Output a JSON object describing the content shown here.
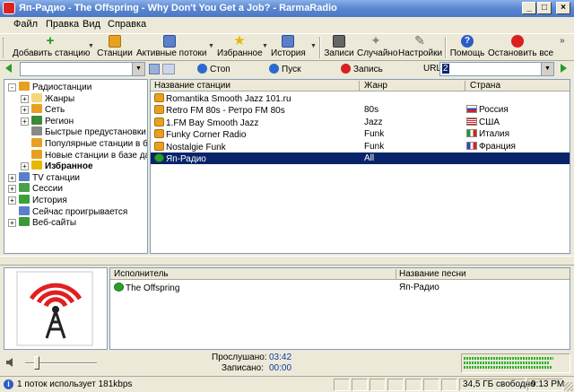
{
  "window": {
    "title": "Яп-Радио - The Offspring - Why Don't You Get a Job? - RarmaRadio"
  },
  "menu": [
    "Файл",
    "Правка",
    "Вид",
    "Справка"
  ],
  "toolbar": {
    "add_station": "Добавить станцию",
    "stations": "Станции",
    "active_streams": "Активные потоки",
    "favorites": "Избранное",
    "history": "История",
    "records": "Записи",
    "random": "Случайно",
    "settings": "Настройки",
    "help": "Помощь",
    "stop_all": "Остановить все"
  },
  "controls": {
    "stop": "Стоп",
    "start": "Пуск",
    "record": "Запись",
    "url_label": "URL",
    "url_value": "2"
  },
  "tree": [
    {
      "label": "Радиостанции",
      "level": 0,
      "exp": "-"
    },
    {
      "label": "Жанры",
      "level": 1,
      "exp": "+"
    },
    {
      "label": "Сеть",
      "level": 1,
      "exp": "+"
    },
    {
      "label": "Регион",
      "level": 1,
      "exp": "+"
    },
    {
      "label": "Быстрые предустановки",
      "level": 1,
      "exp": ""
    },
    {
      "label": "Популярные станции в базе",
      "level": 1,
      "exp": ""
    },
    {
      "label": "Новые станции в базе дан...",
      "level": 1,
      "exp": ""
    },
    {
      "label": "Избранное",
      "level": 1,
      "exp": "+",
      "bold": true
    },
    {
      "label": "TV станции",
      "level": 0,
      "exp": "+"
    },
    {
      "label": "Сессии",
      "level": 0,
      "exp": "+"
    },
    {
      "label": "История",
      "level": 0,
      "exp": "+"
    },
    {
      "label": "Сейчас проигрывается",
      "level": 0,
      "exp": ""
    },
    {
      "label": "Веб-сайты",
      "level": 0,
      "exp": "+"
    }
  ],
  "stations": {
    "columns": [
      "Название станции",
      "Жанр",
      "Страна"
    ],
    "rows": [
      {
        "name": "Romantika Smooth Jazz 101.ru",
        "genre": "",
        "country": ""
      },
      {
        "name": "Retro FM 80s - Ретро FM 80s",
        "genre": "80s",
        "country": "Россия"
      },
      {
        "name": "1.FM Bay Smooth Jazz",
        "genre": "Jazz",
        "country": "США"
      },
      {
        "name": "Funky Corner Radio",
        "genre": "Funk",
        "country": "Италия"
      },
      {
        "name": "Nostalgie Funk",
        "genre": "Funk",
        "country": "Франция"
      },
      {
        "name": "Яп-Радио",
        "genre": "All",
        "country": "",
        "selected": true
      }
    ]
  },
  "songs": {
    "columns": [
      "Исполнитель",
      "Название песни"
    ],
    "rows": [
      {
        "artist": "The Offspring",
        "title": "Яп-Радио"
      }
    ]
  },
  "stats": {
    "listened_label": "Прослушано:",
    "listened_value": "03:42",
    "recorded_label": "Записано:",
    "recorded_value": "00:00"
  },
  "statusbar": {
    "stream_info": "1 поток использует 181kbps",
    "free_space": "34,5 ГБ свободно",
    "time": "9:13 PM"
  },
  "colors": {
    "accent": "#0a246a",
    "logo_red": "#e02020"
  }
}
